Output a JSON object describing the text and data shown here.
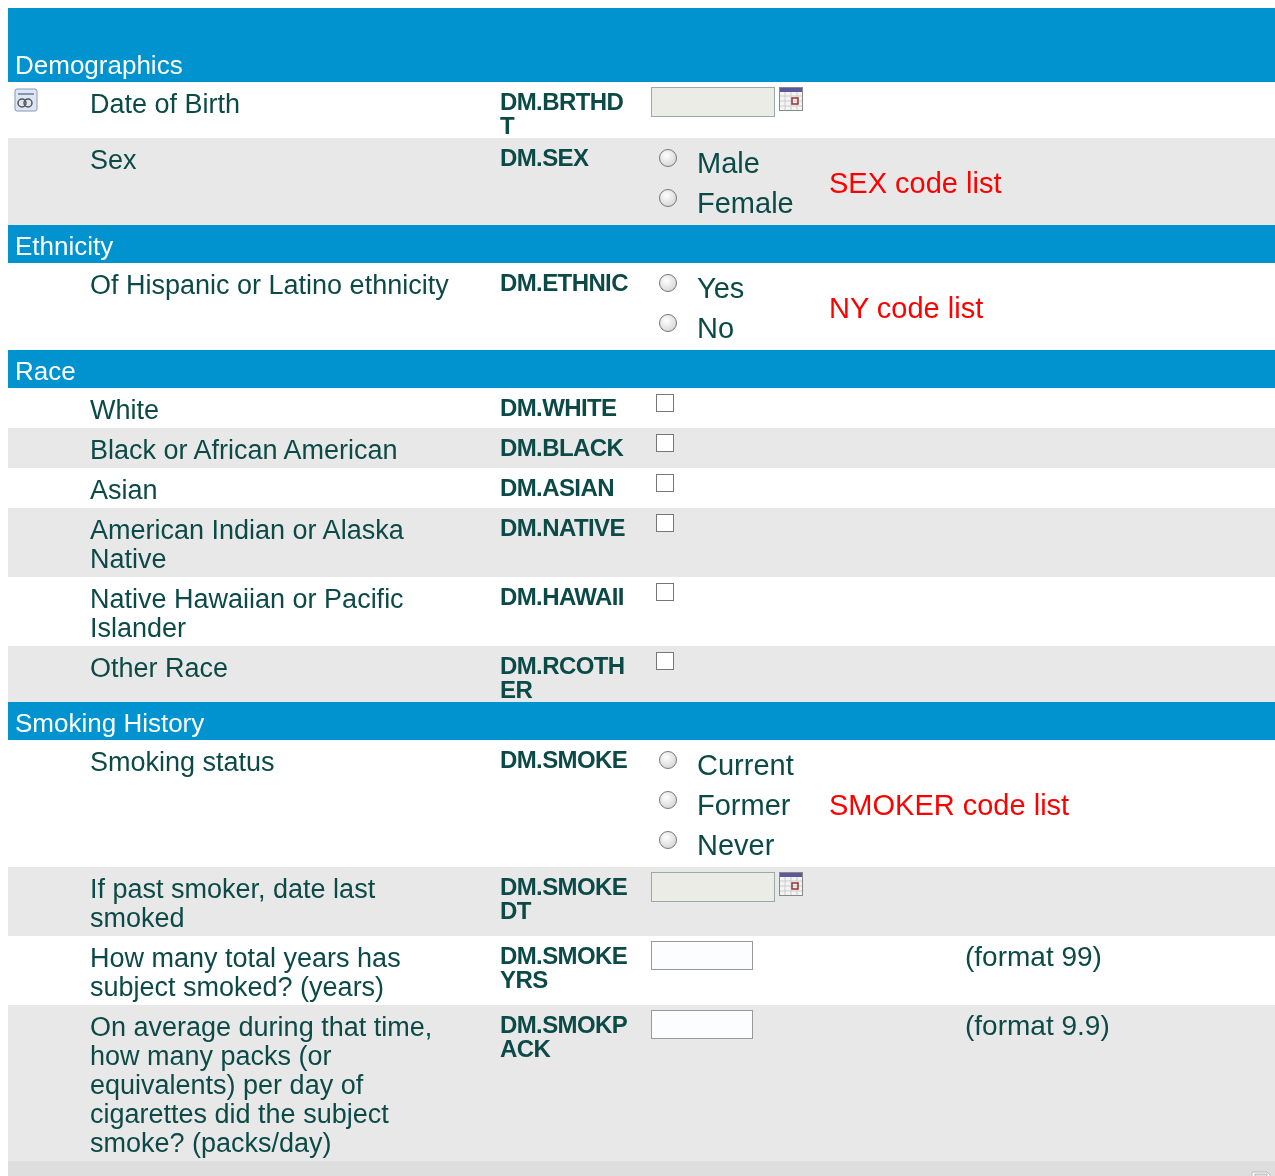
{
  "sections": [
    {
      "title": "Demographics",
      "rows": [
        {
          "kind": "date",
          "label": "Date of Birth",
          "variable": "DM.BRTHDT",
          "has_icon": true
        },
        {
          "kind": "radio",
          "label": "Sex",
          "variable": "DM.SEX",
          "options": [
            {
              "label": "Male",
              "selected": false
            },
            {
              "label": "Female",
              "selected": false
            }
          ],
          "note": {
            "kind": "code",
            "text": "SEX code list"
          }
        }
      ]
    },
    {
      "title": "Ethnicity",
      "rows": [
        {
          "kind": "radio",
          "label": "Of Hispanic or Latino ethnicity",
          "variable": "DM.ETHNIC",
          "options": [
            {
              "label": "Yes",
              "selected": false
            },
            {
              "label": "No",
              "selected": false
            }
          ],
          "note": {
            "kind": "code",
            "text": "NY code list"
          }
        }
      ]
    },
    {
      "title": "Race",
      "rows": [
        {
          "kind": "checkbox",
          "label": "White",
          "variable": "DM.WHITE",
          "checked": false
        },
        {
          "kind": "checkbox",
          "label": "Black or African American",
          "variable": "DM.BLACK",
          "checked": false
        },
        {
          "kind": "checkbox",
          "label": "Asian",
          "variable": "DM.ASIAN",
          "checked": false
        },
        {
          "kind": "checkbox",
          "label": "American Indian or Alaska Native",
          "variable": "DM.NATIVE",
          "checked": false
        },
        {
          "kind": "checkbox",
          "label": "Native Hawaiian or Pacific Islander",
          "variable": "DM.HAWAII",
          "checked": false
        },
        {
          "kind": "checkbox",
          "label": "Other Race",
          "variable": "DM.RCOTHER",
          "checked": false
        }
      ]
    },
    {
      "title": "Smoking History",
      "rows": [
        {
          "kind": "radio",
          "label": "Smoking status",
          "variable": "DM.SMOKE",
          "options": [
            {
              "label": "Current",
              "selected": false
            },
            {
              "label": "Former",
              "selected": false
            },
            {
              "label": "Never",
              "selected": false
            }
          ],
          "note": {
            "kind": "code",
            "text": "SMOKER code list"
          }
        },
        {
          "kind": "date",
          "label": "If past smoker, date last smoked",
          "variable": "DM.SMOKEDT"
        },
        {
          "kind": "text",
          "label": "How many total years has subject smoked? (years)",
          "variable": "DM.SMOKEYRS",
          "note": {
            "kind": "format",
            "text": "(format 99)"
          }
        },
        {
          "kind": "text",
          "label": "On average during that time, how many packs (or equivalents) per day of cigarettes did the subject smoke? (packs/day)",
          "variable": "DM.SMOKPACK",
          "note": {
            "kind": "format",
            "text": "(format 9.9)"
          }
        }
      ]
    }
  ]
}
